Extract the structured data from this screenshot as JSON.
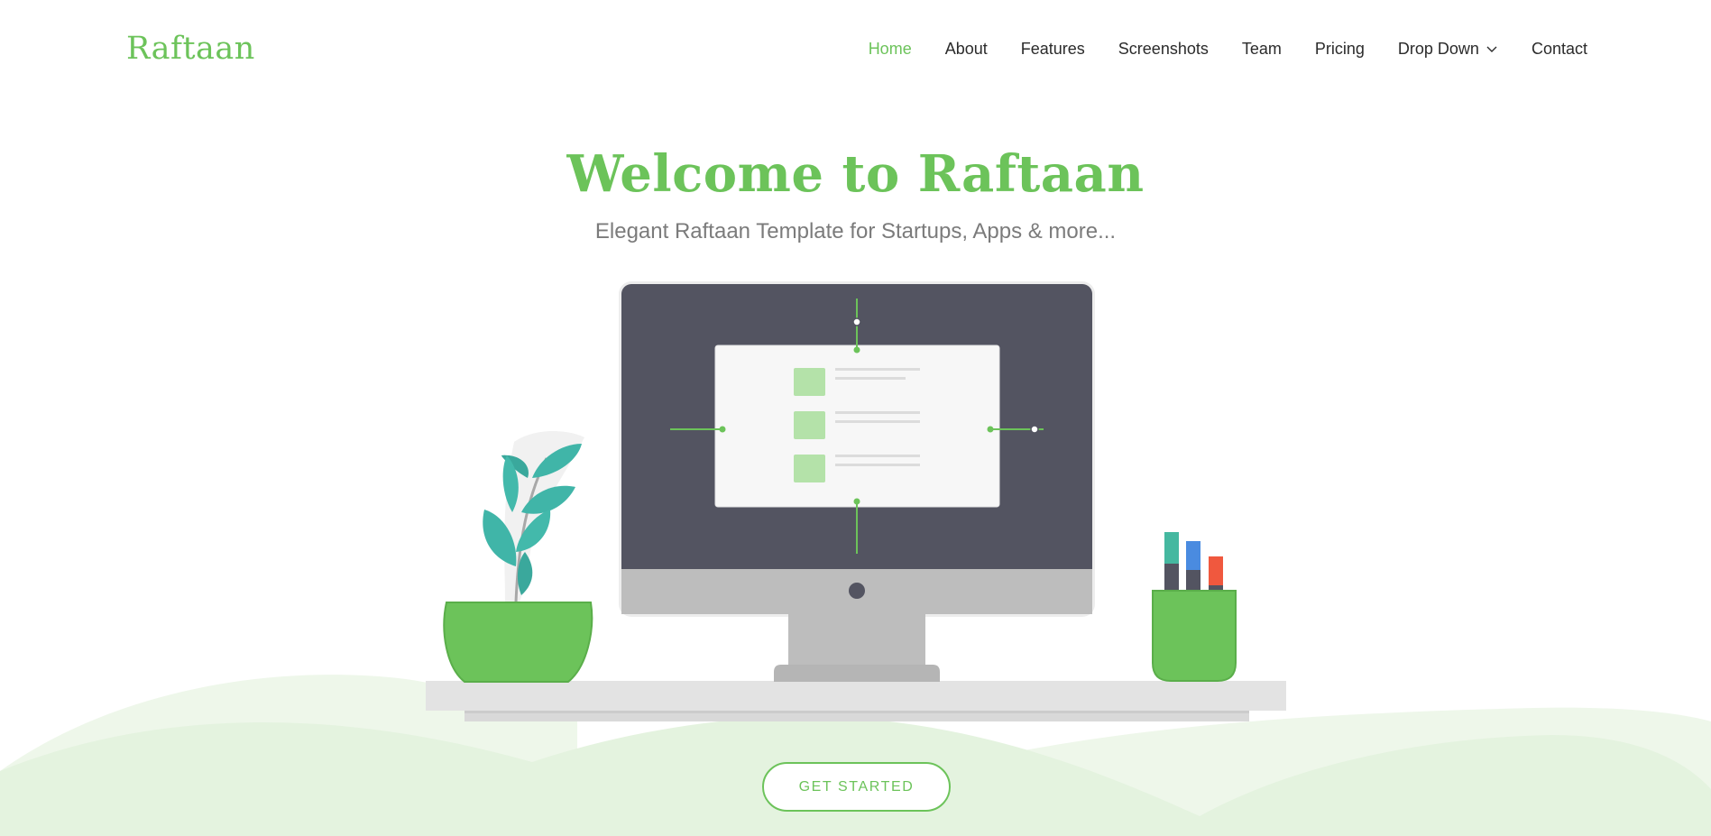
{
  "brand": {
    "logo_text": "Raftaan",
    "accent_color": "#6cc35a"
  },
  "nav": {
    "items": [
      {
        "label": "Home",
        "active": true
      },
      {
        "label": "About",
        "active": false
      },
      {
        "label": "Features",
        "active": false
      },
      {
        "label": "Screenshots",
        "active": false
      },
      {
        "label": "Team",
        "active": false
      },
      {
        "label": "Pricing",
        "active": false
      },
      {
        "label": "Drop Down",
        "active": false,
        "icon": "chevron-down-icon"
      },
      {
        "label": "Contact",
        "active": false
      }
    ]
  },
  "hero": {
    "title": "Welcome to Raftaan",
    "subtitle": "Elegant Raftaan Template for Startups, Apps & more...",
    "cta_label": "GET STARTED",
    "illustration": "desk-illustration"
  }
}
